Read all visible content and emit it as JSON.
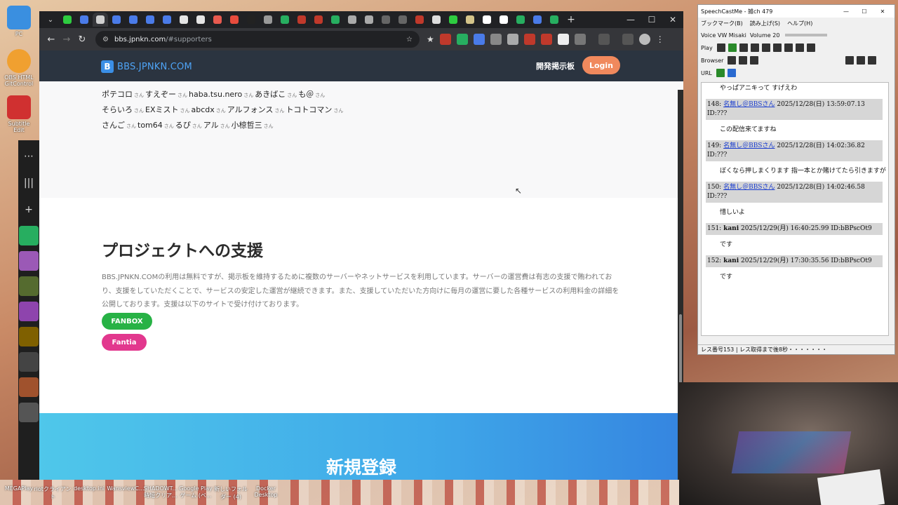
{
  "desktop": {
    "icons": [
      {
        "label": "PC",
        "color": "#3a8fe0"
      },
      {
        "label": "OBS HTML GitControl",
        "color": "#f0a030"
      },
      {
        "label": "Subtitle Edit",
        "color": "#d03030"
      }
    ],
    "taskbar_items": [
      "MEGAPlay",
      "riotクライアント",
      "desktop.ini",
      "WansviewC...",
      "SHADOWT... 時短クリア...",
      "Google Play ゲーム (ベ...",
      "新しいフォルダー (4)",
      "Docker Desktop"
    ]
  },
  "browser": {
    "tab_colors": [
      "#2ecc40",
      "#4a7be8",
      "#d0d0d0",
      "#4a7be8",
      "#4a7be8",
      "#4a7be8",
      "#4a7be8",
      "#e5e5e5",
      "#e5e5e5",
      "#e85a4f",
      "#e84c3d",
      "#222",
      "#999",
      "#27ae60",
      "#c0392b",
      "#c0392b",
      "#27ae60",
      "#aaa",
      "#aaa",
      "#666",
      "#666",
      "#c0392b",
      "#ddd",
      "#2ecc40",
      "#d4c48a",
      "#fff",
      "#fff",
      "#27ae60",
      "#4a7be8",
      "#27ae60"
    ],
    "url_host": "bbs.jpnkn.com",
    "url_path": "/#supporters",
    "site": {
      "logo_letter": "B",
      "logo_text": "BBS.JPNKN.COM",
      "nav_link": "開発掲示板",
      "login": "Login"
    },
    "supporters": {
      "suffix": "さん",
      "lines": [
        [
          "ポテコロ",
          "すえぞー",
          "haba.tsu.nero",
          "あきばこ",
          "も＠"
        ],
        [
          "そらいろ",
          "EXミスト",
          "abcdx",
          "アルフォンス",
          "トコトコマン"
        ],
        [
          "さんご",
          "tom64",
          "るぴ",
          "アル",
          "小椋哲三"
        ]
      ]
    },
    "project": {
      "title": "プロジェクトへの支援",
      "description": "BBS.JPNKN.COMの利用は無料ですが、掲示板を維持するために複数のサーバーやネットサービスを利用しています。サーバーの運営費は有志の支援で賄われており、支援をしていただくことで、サービスの安定した運営が継続できます。また、支援していただいた方向けに毎月の運営に要した各種サービスの利用料金の詳細を公開しております。支援は以下のサイトで受け付けております。",
      "fanbox": "FANBOX",
      "fantia": "Fantia"
    },
    "register": {
      "title": "新規登録"
    }
  },
  "speechcast": {
    "title": "SpeechCastMe - 雑ch 479",
    "menu": [
      "ブックマーク(B)",
      "読み上げ(S)",
      "ヘルプ(H)"
    ],
    "voice_label": "Voice",
    "voice_value": "VW Misaki",
    "volume_label": "Volume",
    "volume_value": "20",
    "play_label": "Play",
    "browser_label": "Browser",
    "url_label": "URL",
    "top_text": "やっぱアニキって すげえわ",
    "posts": [
      {
        "head_num": "148:",
        "name": "名無し＠BBSさん",
        "date": "2025/12/28(日) 13:59:07.13 ID:???",
        "body": "この配信来てますね"
      },
      {
        "head_num": "149:",
        "name": "名無し＠BBSさん",
        "date": "2025/12/28(日) 14:02:36.82 ID:???",
        "body": "ぼくなら押しまくります 指一本とか賭けてたら引きますが"
      },
      {
        "head_num": "150:",
        "name": "名無し＠BBSさん",
        "date": "2025/12/28(日) 14:02:46.58 ID:???",
        "body": "惜しいよ"
      },
      {
        "head_num": "151:",
        "name": "kani",
        "date": "2025/12/29(月) 16:40:25.99 ID:bBPscOt9",
        "body": "です"
      },
      {
        "head_num": "152:",
        "name": "kani",
        "date": "2025/12/29(月) 17:30:35.56 ID:bBPscOt9",
        "body": "です"
      }
    ],
    "status_count": "レス番号153",
    "status_text": "レス取得まで後8秒・・・・・・・"
  }
}
